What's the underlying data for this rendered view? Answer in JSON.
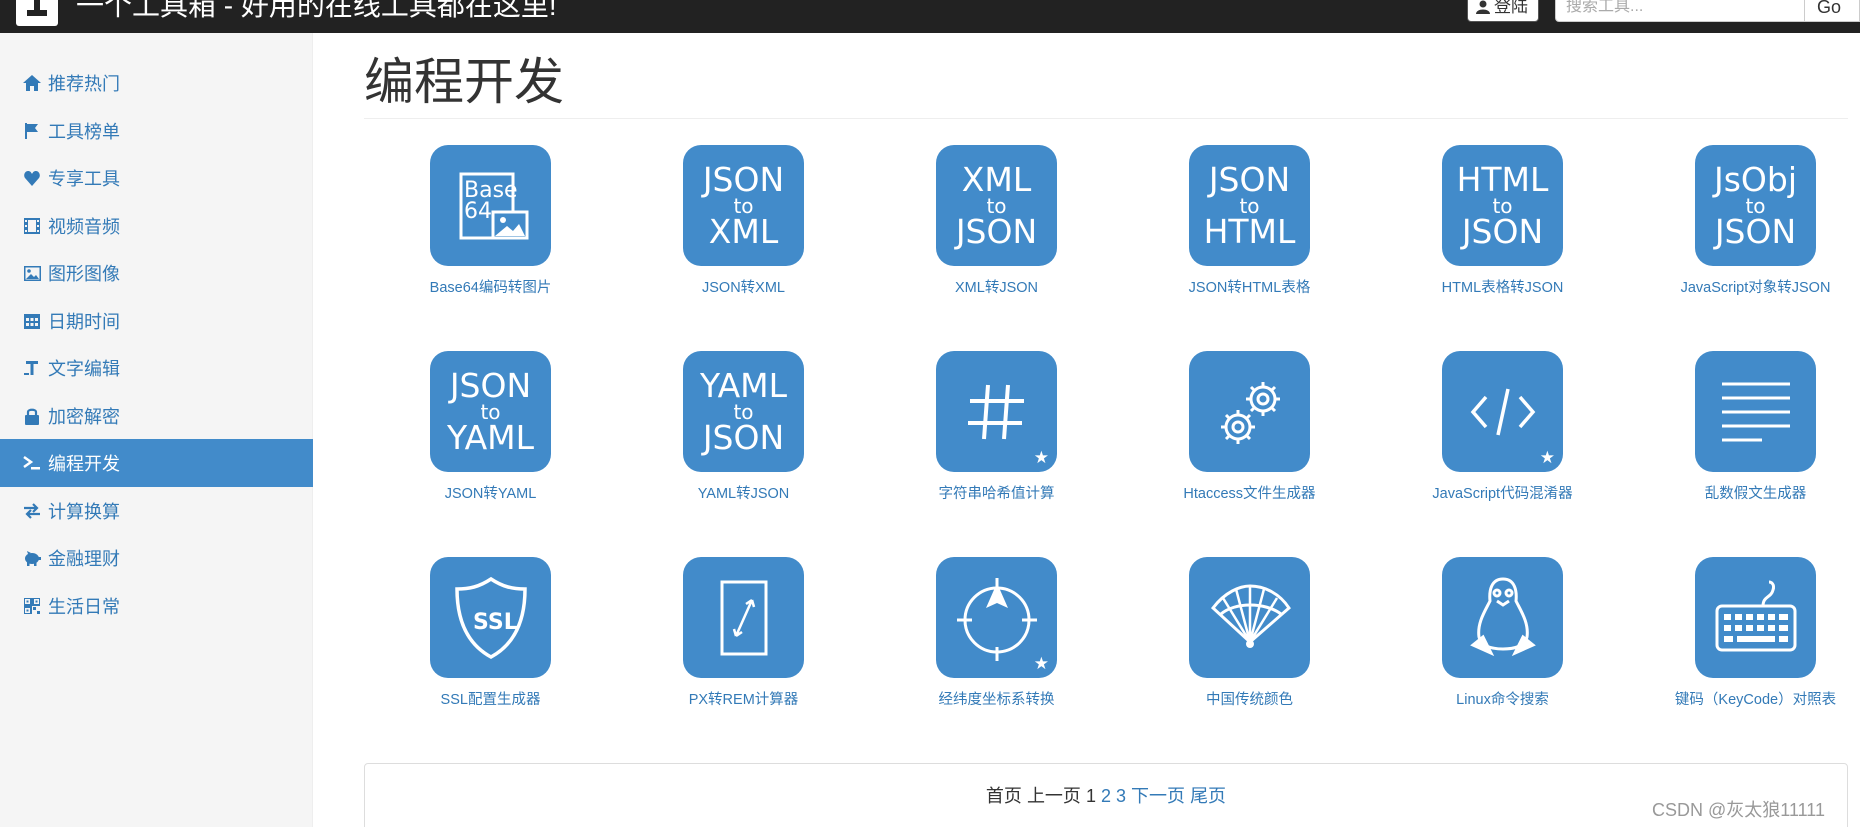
{
  "header": {
    "title": "一个工具箱 - 好用的在线工具都在这里!",
    "login_label": "登陆",
    "search_placeholder": "搜索工具...",
    "go_label": "Go"
  },
  "sidebar": {
    "items": [
      {
        "label": "推荐热门",
        "icon": "home-icon"
      },
      {
        "label": "工具榜单",
        "icon": "flag-icon"
      },
      {
        "label": "专享工具",
        "icon": "heart-icon"
      },
      {
        "label": "视频音频",
        "icon": "film-icon"
      },
      {
        "label": "图形图像",
        "icon": "picture-icon"
      },
      {
        "label": "日期时间",
        "icon": "calendar-icon"
      },
      {
        "label": "文字编辑",
        "icon": "text-size-icon"
      },
      {
        "label": "加密解密",
        "icon": "lock-icon"
      },
      {
        "label": "编程开发",
        "icon": "console-icon",
        "active": true
      },
      {
        "label": "计算换算",
        "icon": "transfer-icon"
      },
      {
        "label": "金融理财",
        "icon": "piggy-bank-icon"
      },
      {
        "label": "生活日常",
        "icon": "qrcode-icon"
      }
    ]
  },
  "main": {
    "title": "编程开发",
    "tools": [
      {
        "label": "Base64编码转图片",
        "icon": "base64-image-icon",
        "tile_text": [
          "Base",
          "64"
        ]
      },
      {
        "label": "JSON转XML",
        "icon": "json-to-xml-icon",
        "tile_text": [
          "JSON",
          "to",
          "XML"
        ]
      },
      {
        "label": "XML转JSON",
        "icon": "xml-to-json-icon",
        "tile_text": [
          "XML",
          "to",
          "JSON"
        ]
      },
      {
        "label": "JSON转HTML表格",
        "icon": "json-to-html-icon",
        "tile_text": [
          "JSON",
          "to",
          "HTML"
        ]
      },
      {
        "label": "HTML表格转JSON",
        "icon": "html-to-json-icon",
        "tile_text": [
          "HTML",
          "to",
          "JSON"
        ]
      },
      {
        "label": "JavaScript对象转JSON",
        "icon": "jsobj-to-json-icon",
        "tile_text": [
          "JsObj",
          "to",
          "JSON"
        ]
      },
      {
        "label": "JSON转YAML",
        "icon": "json-to-yaml-icon",
        "tile_text": [
          "JSON",
          "to",
          "YAML"
        ]
      },
      {
        "label": "YAML转JSON",
        "icon": "yaml-to-json-icon",
        "tile_text": [
          "YAML",
          "to",
          "JSON"
        ]
      },
      {
        "label": "字符串哈希值计算",
        "icon": "hash-icon",
        "star": true
      },
      {
        "label": "Htaccess文件生成器",
        "icon": "gears-icon"
      },
      {
        "label": "JavaScript代码混淆器",
        "icon": "code-icon",
        "star": true
      },
      {
        "label": "乱数假文生成器",
        "icon": "lines-icon"
      },
      {
        "label": "SSL配置生成器",
        "icon": "ssl-shield-icon"
      },
      {
        "label": "PX转REM计算器",
        "icon": "resize-arrow-icon"
      },
      {
        "label": "经纬度坐标系转换",
        "icon": "compass-icon",
        "star": true
      },
      {
        "label": "中国传统颜色",
        "icon": "fan-icon"
      },
      {
        "label": "Linux命令搜索",
        "icon": "tux-icon"
      },
      {
        "label": "键码（KeyCode）对照表",
        "icon": "keyboard-icon"
      }
    ]
  },
  "pagination": {
    "first": "首页",
    "prev": "上一页",
    "pages": [
      "1",
      "2",
      "3"
    ],
    "current": "1",
    "next": "下一页",
    "last": "尾页"
  },
  "watermark": "CSDN @灰太狼11111",
  "colors": {
    "accent": "#428bca",
    "link": "#337ab7",
    "navbar": "#222222"
  }
}
